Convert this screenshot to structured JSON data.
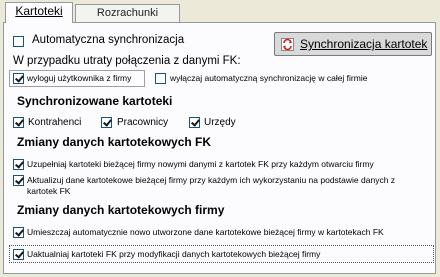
{
  "tabs": [
    {
      "label": "Kartoteki",
      "active": true
    },
    {
      "label": "Rozrachunki",
      "active": false
    }
  ],
  "auto_sync": {
    "label": "Automatyczna synchronizacja",
    "checked": false
  },
  "sync_button": {
    "label": "Synchronizacja kartotek",
    "icon": "sync-icon"
  },
  "connection_loss": {
    "heading": "W przypadku utraty połączenia z danymi FK:",
    "logout": {
      "label": "wyloguj użytkownika z firmy",
      "checked": true
    },
    "disable_auto": {
      "label": "wyłączaj automatyczną synchronizację w całej firmie",
      "checked": false
    }
  },
  "synced_cards": {
    "heading": "Synchronizowane kartoteki",
    "items": [
      {
        "label": "Kontrahenci",
        "checked": true
      },
      {
        "label": "Pracownicy",
        "checked": true
      },
      {
        "label": "Urzędy",
        "checked": true
      }
    ]
  },
  "fk_changes": {
    "heading": "Zmiany danych kartotekowych FK",
    "supplement": {
      "label": "Uzupełniaj kartoteki bieżącej firmy nowymi danymi z kartotek FK przy każdym otwarciu firmy",
      "checked": true
    },
    "update_line1": "Aktualizuj dane kartotekowe bieżącej firmy przy każdym ich wykorzystaniu na podstawie danych z",
    "update_line2": "kartotek FK",
    "update_checked": true
  },
  "company_changes": {
    "heading": "Zmiany danych kartotekowych firmy",
    "place": {
      "label": "Umieszczaj automatycznie nowo utworzone dane kartotekowe bieżącej firmy w kartotekach FK",
      "checked": true
    },
    "update_fk": {
      "label": "Uaktualniaj kartoteki FK przy modyfikacji danych kartotekowych bieżącej firmy",
      "checked": true
    }
  }
}
